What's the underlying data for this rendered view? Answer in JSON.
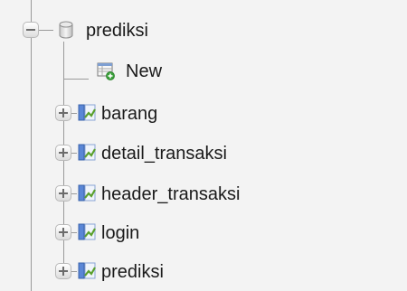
{
  "tree": {
    "database": {
      "name": "prediksi",
      "icon": "database-icon",
      "expanded": true
    },
    "new_item": {
      "label": "New",
      "icon": "new-table-icon"
    },
    "tables": [
      {
        "name": "barang",
        "icon": "table-icon"
      },
      {
        "name": "detail_transaksi",
        "icon": "table-icon"
      },
      {
        "name": "header_transaksi",
        "icon": "table-icon"
      },
      {
        "name": "login",
        "icon": "table-icon"
      },
      {
        "name": "prediksi",
        "icon": "table-icon"
      }
    ]
  },
  "colors": {
    "background": "#f3f3f3",
    "text": "#1a1a1a",
    "tree_line": "#9a9a9a",
    "table_icon_blue": "#4a74c4",
    "table_icon_green": "#5aa02c",
    "new_icon_green": "#3aa13a"
  }
}
